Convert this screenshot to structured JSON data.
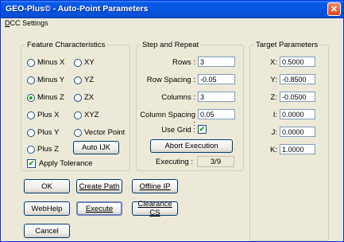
{
  "window": {
    "title": "GEO-Plus© - Auto-Point Parameters",
    "close_glyph": "✕"
  },
  "menubar": {
    "dcc_settings": "DCC Settings",
    "dcc_settings_hotkey": "D",
    "dcc_settings_rest": "CC Settings"
  },
  "feature": {
    "legend": "Feature Characteristics",
    "radios": {
      "minus_x": "Minus X",
      "xy": "XY",
      "minus_y": "Minus Y",
      "yz": "YZ",
      "minus_z": "Minus Z",
      "zx": "ZX",
      "plus_x": "Plus X",
      "xyz": "XYZ",
      "plus_y": "Plus Y",
      "vector_point": "Vector Point",
      "plus_z": "Plus Z"
    },
    "selected": "minus_z",
    "auto_ijk": "Auto IJK",
    "apply_tolerance": "Apply Tolerance",
    "apply_tolerance_checked": true
  },
  "step": {
    "legend": "Step and Repeat",
    "rows_label": "Rows :",
    "rows_value": "3",
    "row_spacing_label": "Row Spacing :",
    "row_spacing_value": "-0.05",
    "columns_label": "Columns :",
    "columns_value": "3",
    "column_spacing_label": "Column Spacing :",
    "column_spacing_value": "0.05",
    "use_grid_label": "Use Grid :",
    "use_grid_checked": true,
    "abort_execution": "Abort Execution",
    "executing_label": "Executing :",
    "executing_value": "3/9"
  },
  "target": {
    "legend": "Target Parameters",
    "x_label": "X:",
    "x_value": "0.5000",
    "y_label": "Y:",
    "y_value": "-0.8500",
    "z_label": "Z:",
    "z_value": "-0.0500",
    "i_label": "I:",
    "i_value": "0.0000",
    "j_label": "J:",
    "j_value": "0.0000",
    "k_label": "K:",
    "k_value": "1.0000"
  },
  "buttons": {
    "ok": "OK",
    "create_path": "Create Path",
    "offline_ip": "Offline IP",
    "webhelp": "WebHelp",
    "execute": "Execute",
    "clearance_cs": "Clearance CS",
    "cancel": "Cancel"
  },
  "colors": {
    "titlebar": "#0a5ae8",
    "window_bg": "#ece9d8",
    "radio_selected": "#21a121",
    "close_button": "#d8481e"
  }
}
